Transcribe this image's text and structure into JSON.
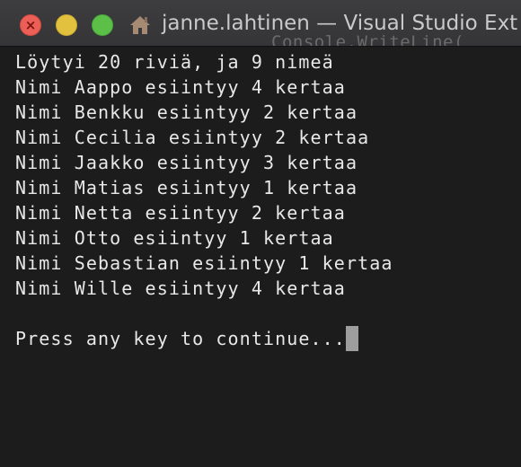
{
  "window": {
    "title": "janne.lahtinen — Visual Studio Ext",
    "background_code": "Console.WriteLine(",
    "title_icon": "home-icon",
    "colors": {
      "close": "#ec5f57",
      "minimize": "#e1c13e",
      "maximize": "#5cbf48",
      "terminal_bg": "#1c1c1c",
      "terminal_text": "#e8e8e8"
    }
  },
  "terminal": {
    "lines": [
      "Löytyi 20 riviä, ja 9 nimeä",
      "Nimi Aappo esiintyy 4 kertaa",
      "Nimi Benkku esiintyy 2 kertaa",
      "Nimi Cecilia esiintyy 2 kertaa",
      "Nimi Jaakko esiintyy 3 kertaa",
      "Nimi Matias esiintyy 1 kertaa",
      "Nimi Netta esiintyy 2 kertaa",
      "Nimi Otto esiintyy 1 kertaa",
      "Nimi Sebastian esiintyy 1 kertaa",
      "Nimi Wille esiintyy 4 kertaa"
    ],
    "prompt": "Press any key to continue..."
  }
}
